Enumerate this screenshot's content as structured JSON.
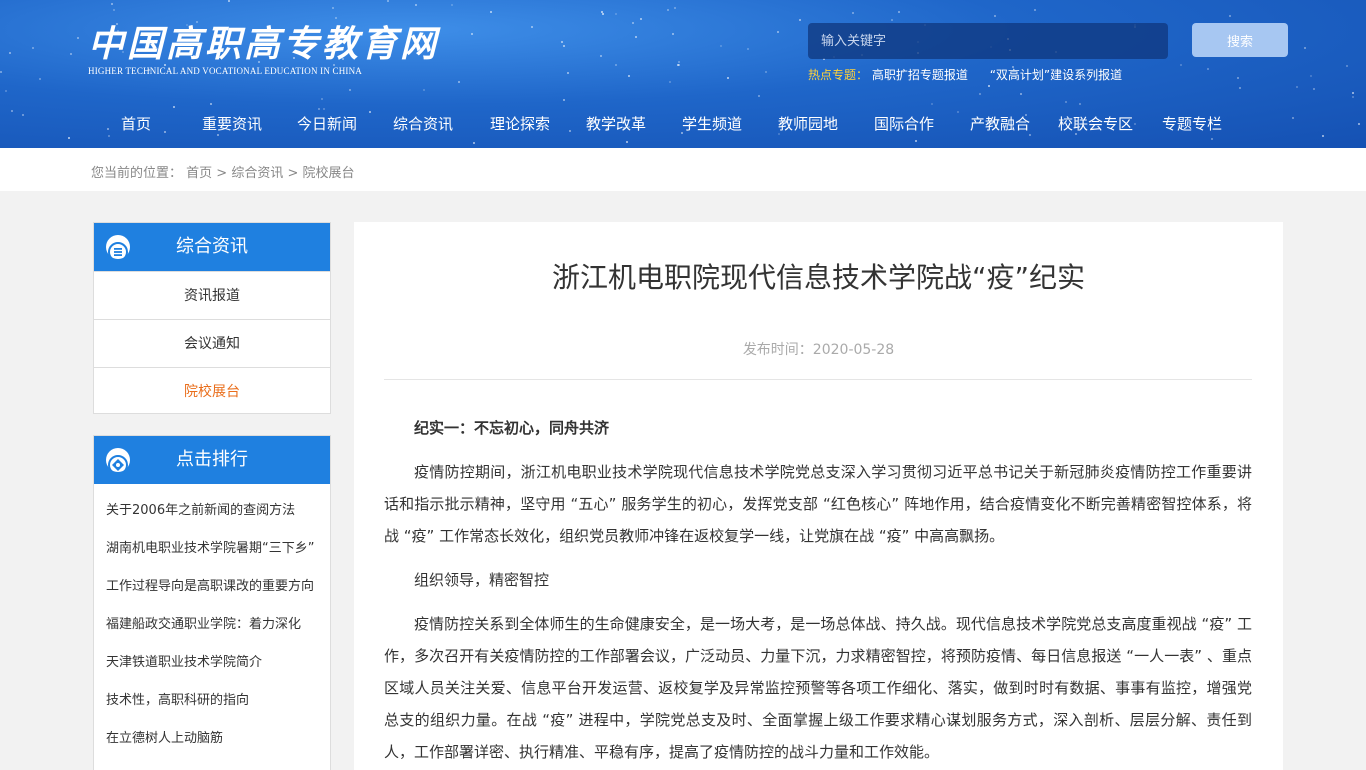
{
  "site": {
    "logo_cn": "中国高职高专教育网",
    "logo_en": "HIGHER TECHNICAL AND VOCATIONAL EDUCATION IN CHINA",
    "search_placeholder": "输入关键字",
    "search_button": "搜索",
    "hot_label": "热点专题：",
    "hot_links": [
      "高职扩招专题报道",
      "“双高计划”建设系列报道"
    ]
  },
  "nav": [
    "首页",
    "重要资讯",
    "今日新闻",
    "综合资讯",
    "理论探索",
    "教学改革",
    "学生频道",
    "教师园地",
    "国际合作",
    "产教融合",
    "校联会专区",
    "专题专栏"
  ],
  "breadcrumb": {
    "prefix": "您当前的位置：",
    "items": [
      "首页",
      "综合资讯",
      "院校展台"
    ],
    "separator": " > "
  },
  "sidebar": {
    "section_title": "综合资讯",
    "items": [
      {
        "label": "资讯报道"
      },
      {
        "label": "会议通知"
      },
      {
        "label": "院校展台"
      }
    ],
    "active_index": 2,
    "rank_title": "点击排行",
    "rank_items": [
      "关于2006年之前新闻的查阅方法",
      "湖南机电职业技术学院暑期“三下乡”",
      "工作过程导向是高职课改的重要方向",
      "福建船政交通职业学院：着力深化",
      "天津铁道职业技术学院简介",
      "技术性，高职科研的指向",
      "在立德树人上动脑筋"
    ]
  },
  "article": {
    "title": "浙江机电职院现代信息技术学院战“疫”纪实",
    "date": "发布时间：2020-05-28",
    "paragraphs": [
      "纪实一：不忘初心，同舟共济",
      "疫情防控期间，浙江机电职业技术学院现代信息技术学院党总支深入学习贯彻习近平总书记关于新冠肺炎疫情防控工作重要讲话和指示批示精神，坚守用 “五心” 服务学生的初心，发挥党支部 “红色核心” 阵地作用，结合疫情变化不断完善精密智控体系，将战 “疫” 工作常态长效化，组织党员教师冲锋在返校复学一线，让党旗在战 “疫” 中高高飘扬。",
      "组织领导，精密智控",
      "疫情防控关系到全体师生的生命健康安全，是一场大考，是一场总体战、持久战。现代信息技术学院党总支高度重视战 “疫” 工作，多次召开有关疫情防控的工作部署会议，广泛动员、力量下沉，力求精密智控，将预防疫情、每日信息报送 “一人一表” 、重点区域人员关注关爱、信息平台开发运营、返校复学及异常监控预警等各项工作细化、落实，做到时时有数据、事事有监控，增强党总支的组织力量。在战 “疫” 进程中，学院党总支及时、全面掌握上级工作要求精心谋划服务方式，深入剖析、层层分解、责任到人，工作部署详密、执行精准、平稳有序，提高了疫情防控的战斗力量和工作效能。"
    ]
  },
  "colors": {
    "header_blue": "#1f66c9",
    "sidebar_blue": "#1f80e0",
    "active_orange": "#e96d1a",
    "hot_yellow": "#ffd23b"
  }
}
